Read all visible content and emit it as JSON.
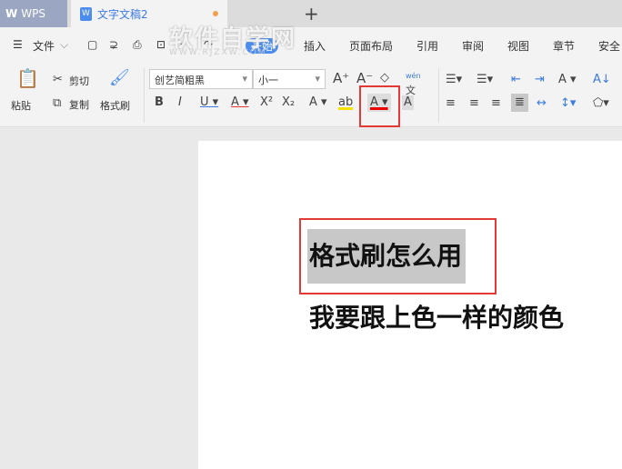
{
  "app": {
    "name": "WPS",
    "doc_tab": "文字文稿2",
    "new_tab": "+"
  },
  "menu": {
    "file": "文件",
    "tabs": [
      "开始",
      "插入",
      "页面布局",
      "引用",
      "审阅",
      "视图",
      "章节",
      "安全"
    ]
  },
  "watermark": {
    "title": "软件自学网",
    "url": "WWW.RJZXW.COM"
  },
  "ribbon": {
    "paste": "粘贴",
    "cut": "剪切",
    "copy": "复制",
    "format_painter": "格式刷",
    "font": "创艺简粗黑",
    "size": "小一",
    "pinyin": "wén",
    "pinyin_char": "文"
  },
  "document": {
    "line1": "格式刷怎么用",
    "line2": "我要跟上色一样的颜色"
  },
  "colors": {
    "accent": "#4a8cf0",
    "highlight": "#e53935"
  }
}
